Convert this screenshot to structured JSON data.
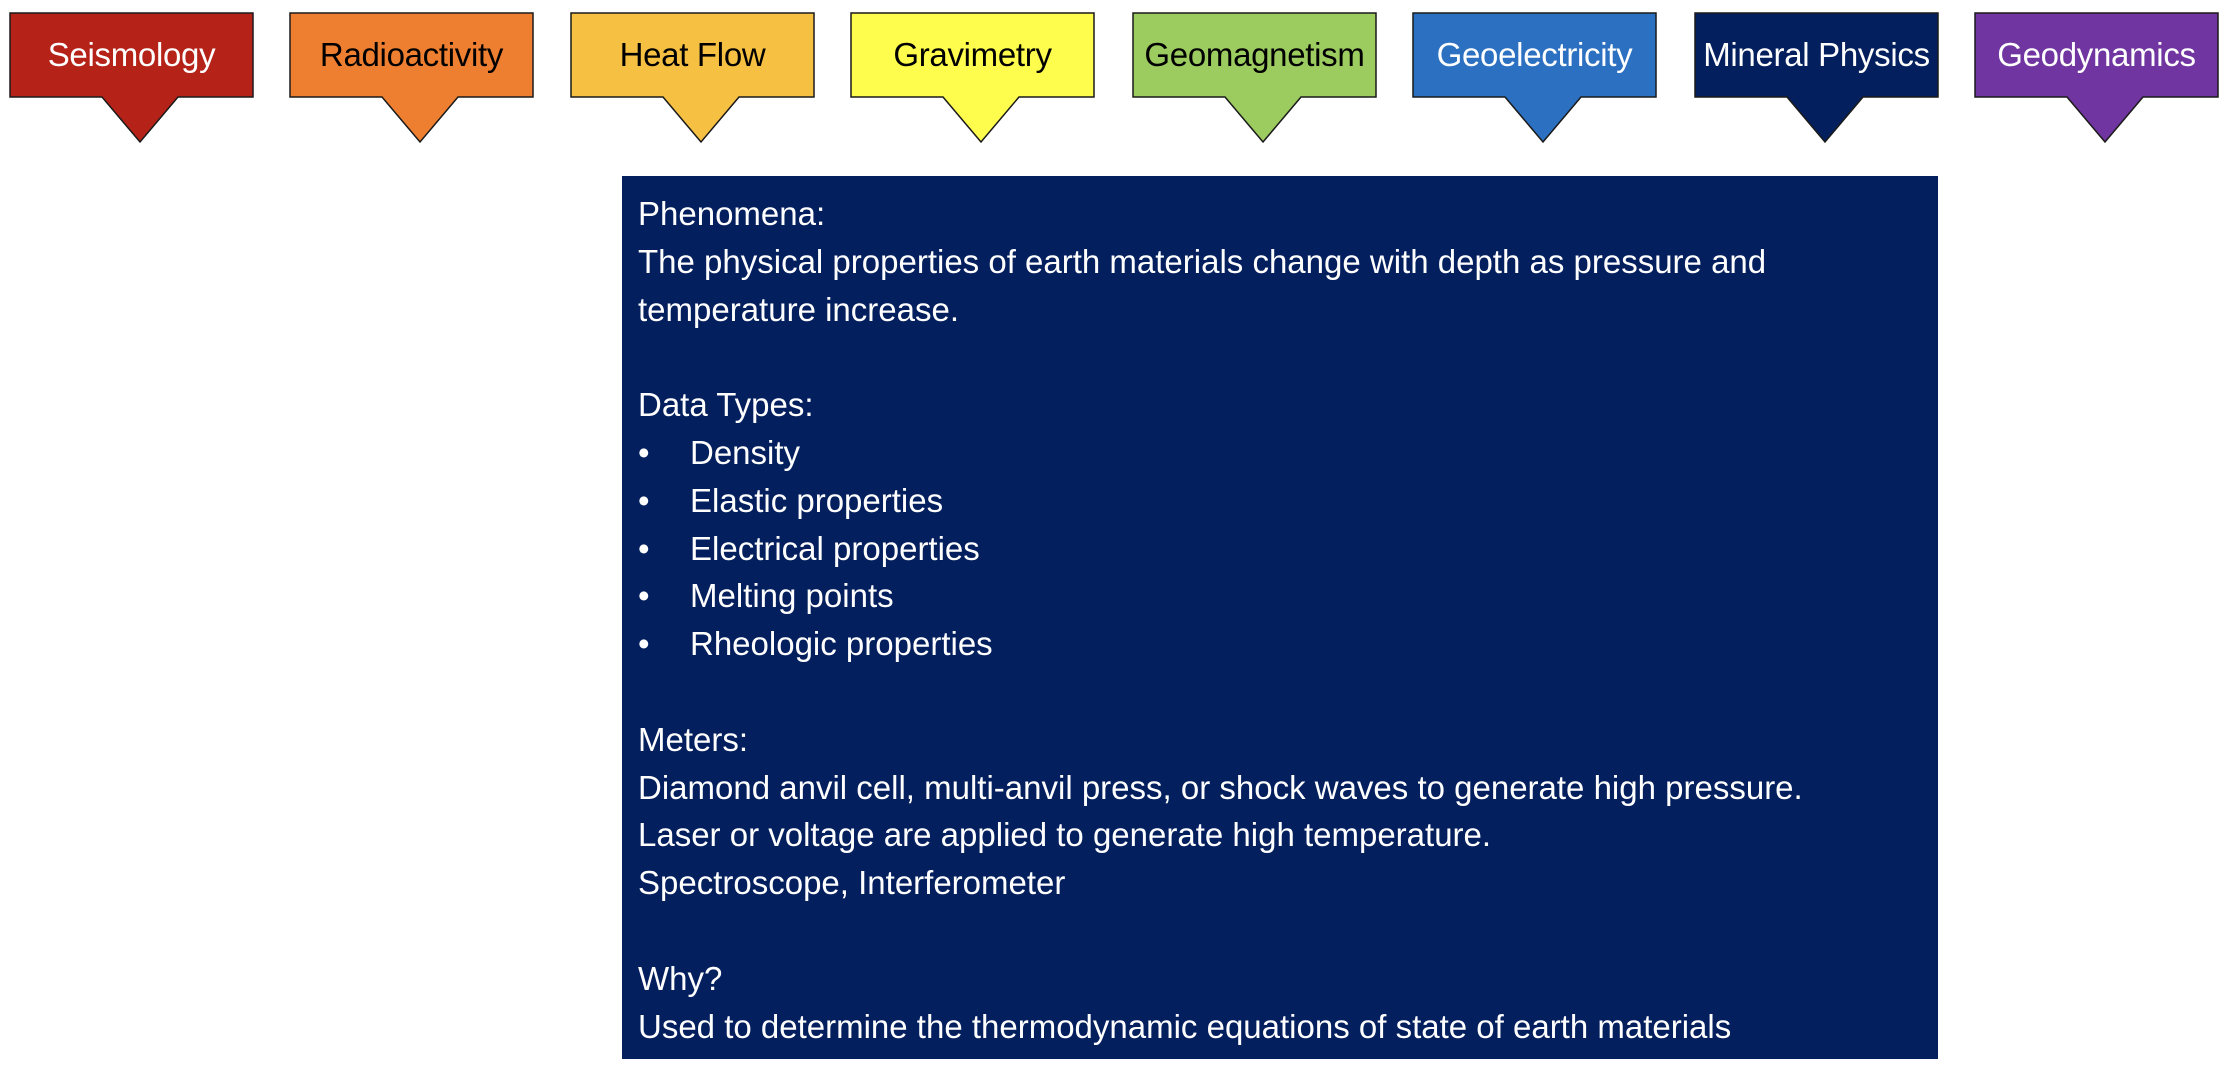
{
  "categories": [
    {
      "label": "Seismology",
      "fill": "#b52218",
      "text_color": "#ffffff"
    },
    {
      "label": "Radioactivity",
      "fill": "#ef7f30",
      "text_color": "#000000"
    },
    {
      "label": "Heat Flow",
      "fill": "#f6c142",
      "text_color": "#000000"
    },
    {
      "label": "Gravimetry",
      "fill": "#fefc4c",
      "text_color": "#000000"
    },
    {
      "label": "Geomagnetism",
      "fill": "#9ccb5f",
      "text_color": "#000000"
    },
    {
      "label": "Geoelectricity",
      "fill": "#2c70c1",
      "text_color": "#ffffff"
    },
    {
      "label": "Mineral Physics",
      "fill": "#041f5d",
      "text_color": "#ffffff"
    },
    {
      "label": "Geodynamics",
      "fill": "#7035a0",
      "text_color": "#ffffff"
    }
  ],
  "selected_category": "Mineral Physics",
  "detail": {
    "phenomena_heading": "Phenomena:",
    "phenomena_line1": "The physical properties of earth materials change with depth as pressure and",
    "phenomena_line2": "temperature increase.",
    "data_types_heading": "Data Types:",
    "data_types": [
      "Density",
      "Elastic properties",
      "Electrical properties",
      "Melting points",
      "Rheologic properties"
    ],
    "meters_heading": "Meters:",
    "meters_lines": [
      "Diamond anvil cell, multi-anvil press, or shock waves to generate high pressure.",
      "Laser or voltage are applied to generate high temperature.",
      "Spectroscope, Interferometer"
    ],
    "why_heading": "Why?",
    "why_text": "Used to determine the thermodynamic equations of state of earth materials"
  }
}
